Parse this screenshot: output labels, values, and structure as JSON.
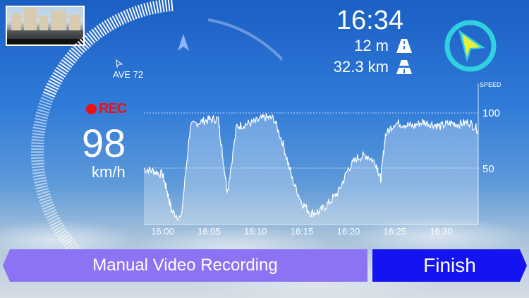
{
  "status": {
    "time": "16:34",
    "distance_near": "12 m",
    "distance_total": "32.3 km",
    "speed_limit_label": "AVE 72",
    "recording_label": "REC",
    "speed_value": "98",
    "speed_unit": "km/h"
  },
  "icons": {
    "compass": "compass-arrow-icon",
    "road": "road-icon",
    "highway": "highway-icon",
    "rec_dot": "record-dot-icon",
    "heading": "heading-arrow-icon"
  },
  "colors": {
    "rec": "#e11111",
    "manual_btn": "#8b73f4",
    "finish_btn": "#1414f2",
    "compass": "#2fd0e0",
    "compass_arrow": "#e8f03a"
  },
  "chart_data": {
    "type": "area",
    "ylabel": "SPEED",
    "y_ticks": [
      "100",
      "50"
    ],
    "x_ticks": [
      "16:00",
      "16:05",
      "16:10",
      "16:15",
      "16:20",
      "16:25",
      "16:30"
    ],
    "ylim": [
      0,
      115
    ],
    "x_minutes_range": [
      15.8,
      16.39
    ],
    "series": [
      {
        "x": [
          "15:58",
          "15:59",
          "16:00",
          "16:00:30",
          "16:01",
          "16:02",
          "16:03",
          "16:04",
          "16:05",
          "16:06",
          "16:06:30",
          "16:07",
          "16:08",
          "16:09",
          "16:10",
          "16:11",
          "16:12",
          "16:13",
          "16:14",
          "16:15",
          "16:16",
          "16:17",
          "16:18",
          "16:19",
          "16:20",
          "16:21",
          "16:22",
          "16:23",
          "16:23:30",
          "16:24",
          "16:25",
          "16:26",
          "16:27",
          "16:28",
          "16:29",
          "16:30",
          "16:31",
          "16:32",
          "16:33",
          "16:34"
        ],
        "values": [
          50,
          48,
          45,
          30,
          12,
          5,
          88,
          92,
          94,
          95,
          60,
          30,
          88,
          90,
          92,
          96,
          95,
          72,
          40,
          20,
          10,
          12,
          20,
          30,
          50,
          60,
          62,
          55,
          40,
          80,
          91,
          90,
          88,
          92,
          90,
          88,
          91,
          90,
          92,
          85
        ]
      }
    ]
  },
  "buttons": {
    "manual": "Manual Video Recording",
    "finish": "Finish"
  }
}
